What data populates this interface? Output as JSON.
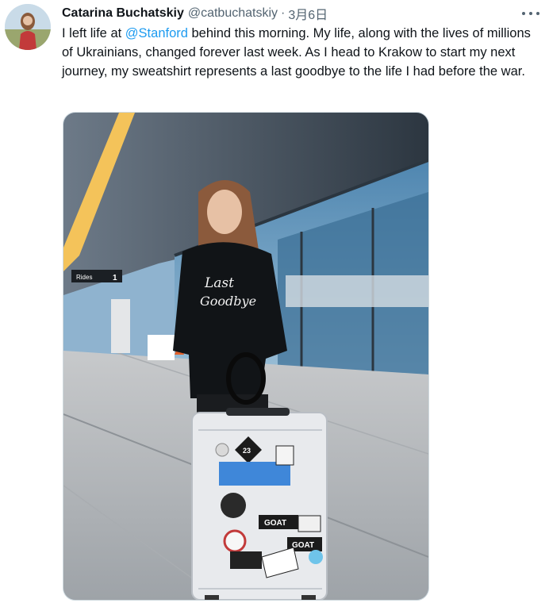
{
  "tweet": {
    "author_name": "Catarina Buchatskiy",
    "handle": "@catbuchatskiy",
    "separator": "·",
    "date": "3月6日",
    "text_before_mention": "I left life at ",
    "mention": "@Stanford",
    "text_after_mention": " behind this morning. My life, along with the lives of millions of Ukrainians, changed forever last week. As I head to Krakow to start my next journey, my sweatshirt represents a last goodbye to the life I had before the war."
  },
  "photo": {
    "sweatshirt_text_line1": "Last",
    "sweatshirt_text_line2": "Goodbye",
    "sign_text": "Rides",
    "sign_number": "1",
    "sticker_number": "23",
    "sticker_goat": "GOAT"
  },
  "colors": {
    "link": "#1d9bf0",
    "secondary_text": "#536471",
    "primary_text": "#0f1419"
  }
}
